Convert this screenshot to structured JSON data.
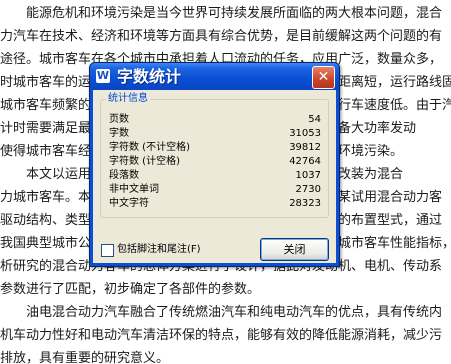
{
  "document": {
    "lines": [
      "能源危机和环境污染是当今世界可持续发展所面临的两大根本问题，混合",
      "力汽车在技术、经济和环境等方面具有综合优势，是目前缓解这两个问题的有",
      "途径。城市客车在各个城市中承担着人口流动的任务，应用广泛，数量众多，",
      "时城市客车的运营特点是行驶工况复杂，平均车速低，行驶距离短，运行路线固",
      "城市客车频繁的起步、停车、加速、减速，造成较大的平均行车速度低。由于汽车",
      "计时需要满足最大加速性能和最高车速的要求，因此需要装备大功率发动",
      "使得城市客车经常处于低负荷工况下运行，造成燃油浪费和环境污染。",
      "本文以运用具有代表性的城市客车作为研究对象，将其改装为混合",
      "力城市客车。本文在分析了混合动力汽车的基本结构，根据某试用混合动力客",
      "驱动结构、类型及其特点的基础上，确定了该混合动力汽车的布置型式，通过",
      "我国典型城市公交车的工况特点和控制要求，对该混合动力城市客车性能指标，并",
      "析研究的混合动力客车的总体方案进行了设计，据此对发动机、电机、传动系",
      "参数进行了匹配，初步确定了各部件的参数。",
      "油电混合动力汽车融合了传统燃油汽车和纯电动汽车的优点，具有传统内",
      "机车动力性好和电动汽车清洁环保的特点，能够有效的降低能源消耗，减少污",
      "排放，具有重要的研究意义。"
    ]
  },
  "dialog": {
    "title": "字数统计",
    "title_icon": "W",
    "close_glyph": "✕",
    "group_label": "统计信息",
    "stats": [
      {
        "label": "页数",
        "value": "54"
      },
      {
        "label": "字数",
        "value": "31053"
      },
      {
        "label": "字符数 (不计空格)",
        "value": "39812"
      },
      {
        "label": "字符数 (计空格)",
        "value": "42764"
      },
      {
        "label": "段落数",
        "value": "1037"
      },
      {
        "label": "非中文单词",
        "value": "2730"
      },
      {
        "label": "中文字符",
        "value": "28323"
      }
    ],
    "checkbox_label": "包括脚注和尾注(F)",
    "checkbox_checked": false,
    "close_button_label": "关闭"
  }
}
